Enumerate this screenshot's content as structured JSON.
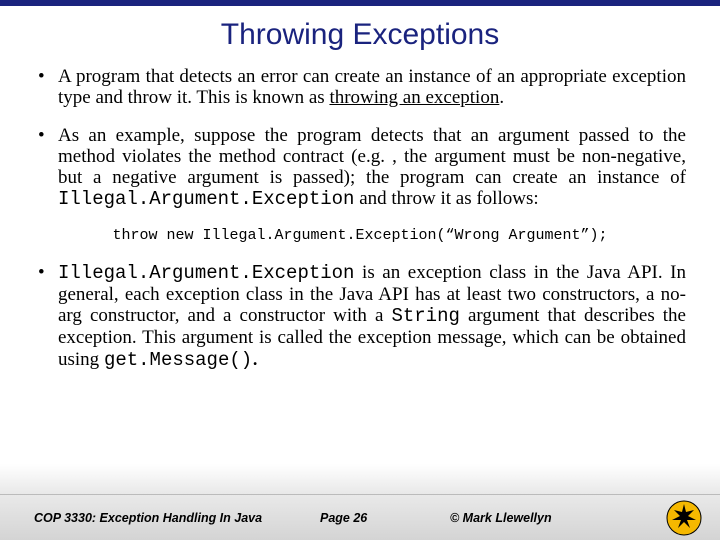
{
  "title": "Throwing Exceptions",
  "bullets": {
    "b1_pre": "A program that detects an error can create an instance of an appropriate exception type and throw it.  This is known as ",
    "b1_underlined": "throwing an exception",
    "b1_post": ".",
    "b2_pre": "As an example, suppose the program detects that an argument passed to the method violates the method contract (e.g. , the argument must be non-negative, but a negative argument is passed); the program can create an instance of ",
    "b2_code": "Illegal.Argument.Exception",
    "b2_post": " and throw it as follows:",
    "code_line": "throw new Illegal.Argument.Exception(“Wrong Argument”);",
    "b3_code1": "Illegal.Argument.Exception",
    "b3_mid": " is an exception class in the Java API.  In general, each exception class in the Java API has at least two constructors, a no-arg constructor, and a constructor with a ",
    "b3_code2": "String",
    "b3_mid2": " argument that describes the exception.   This argument is called the exception message, which can be obtained using ",
    "b3_code3": "get.Message()",
    "b3_post": "."
  },
  "footer": {
    "course": "COP 3330:  Exception Handling In Java",
    "page": "Page 26",
    "author": "© Mark Llewellyn"
  },
  "colors": {
    "brand": "#1a237e",
    "logo_gold": "#f5b800"
  }
}
